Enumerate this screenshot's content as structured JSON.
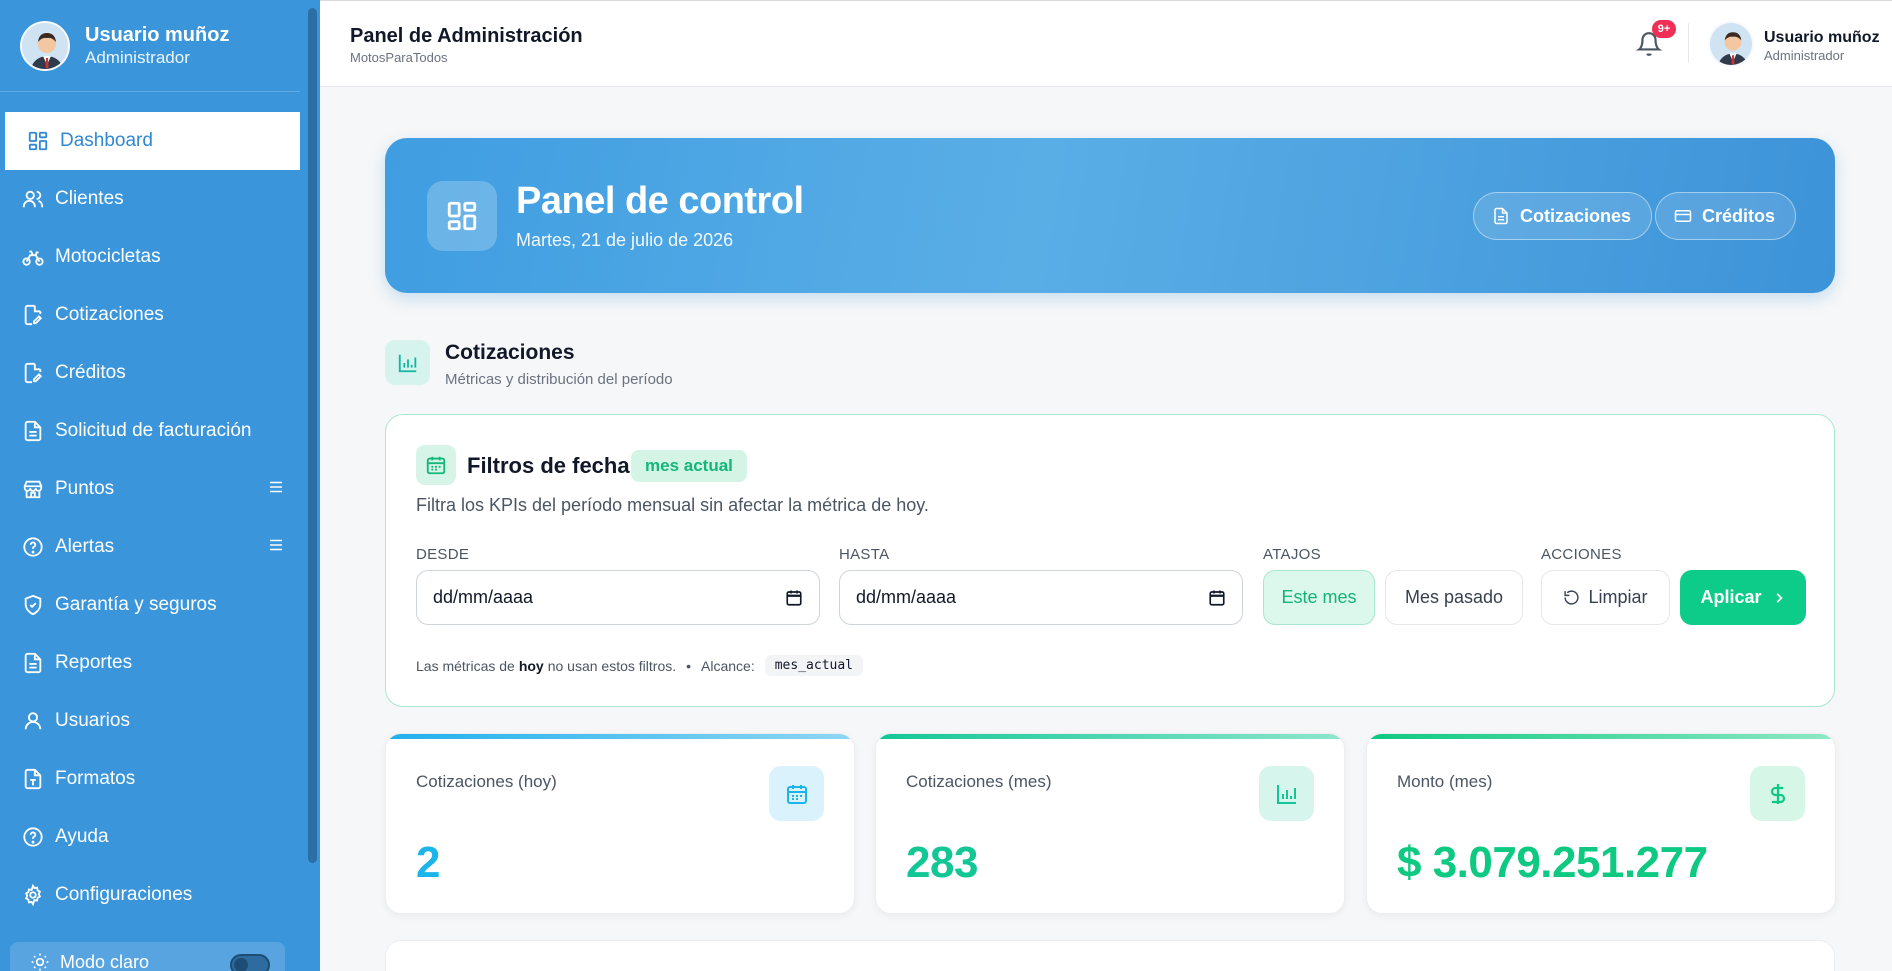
{
  "sidebar": {
    "user_name": "Usuario muñoz",
    "user_role": "Administrador",
    "items": [
      {
        "label": "Dashboard",
        "icon": "dashboard-icon",
        "active": true
      },
      {
        "label": "Clientes",
        "icon": "users-icon"
      },
      {
        "label": "Motocicletas",
        "icon": "bike-icon"
      },
      {
        "label": "Cotizaciones",
        "icon": "file-edit-icon"
      },
      {
        "label": "Créditos",
        "icon": "file-edit-icon"
      },
      {
        "label": "Solicitud de facturación",
        "icon": "document-icon"
      },
      {
        "label": "Puntos",
        "icon": "store-icon",
        "has_menu": true
      },
      {
        "label": "Alertas",
        "icon": "help-circle-icon",
        "has_menu": true
      },
      {
        "label": "Garantía y seguros",
        "icon": "shield-icon"
      },
      {
        "label": "Reportes",
        "icon": "document-icon"
      },
      {
        "label": "Usuarios",
        "icon": "user-icon"
      },
      {
        "label": "Formatos",
        "icon": "file-text-icon"
      },
      {
        "label": "Ayuda",
        "icon": "help-circle-icon"
      },
      {
        "label": "Configuraciones",
        "icon": "gear-icon"
      }
    ],
    "mode_label": "Modo claro"
  },
  "topbar": {
    "title": "Panel de Administración",
    "subtitle": "MotosParaTodos",
    "notifications_badge": "9+",
    "user_name": "Usuario muñoz",
    "user_role": "Administrador"
  },
  "hero": {
    "title": "Panel de control",
    "date": "Martes, 21 de julio de 2026",
    "btn_cotizaciones": "Cotizaciones",
    "btn_creditos": "Créditos"
  },
  "section": {
    "title": "Cotizaciones",
    "subtitle": "Métricas y distribución del período"
  },
  "filters": {
    "title": "Filtros de fecha",
    "badge": "mes actual",
    "description": "Filtra los KPIs del período mensual sin afectar la métrica de hoy.",
    "label_desde": "DESDE",
    "label_hasta": "HASTA",
    "label_atajos": "ATAJOS",
    "label_acciones": "ACCIONES",
    "desde_placeholder": "dd/mm/aaaa",
    "hasta_placeholder": "dd/mm/aaaa",
    "chip_este_mes": "Este mes",
    "chip_mes_pasado": "Mes pasado",
    "btn_limpiar": "Limpiar",
    "btn_aplicar": "Aplicar",
    "foot_pre": "Las métricas de",
    "foot_bold": "hoy",
    "foot_post": "no usan estos filtros.",
    "foot_bullet": "•",
    "foot_alcance": "Alcance:",
    "foot_code": "mes_actual"
  },
  "kpis": [
    {
      "label": "Cotizaciones (hoy)",
      "value": "2",
      "color": "#1bb5ec",
      "icon": "calendar-icon"
    },
    {
      "label": "Cotizaciones (mes)",
      "value": "283",
      "color": "#12c795",
      "icon": "bar-chart-icon"
    },
    {
      "label": "Monto (mes)",
      "value": "$ 3.079.251.277",
      "color": "#0dc982",
      "icon": "dollar-icon"
    }
  ],
  "colors": {
    "sidebar_bg": "#3b95db",
    "accent_green": "#0dcc8a",
    "accent_blue": "#3f9de1"
  }
}
